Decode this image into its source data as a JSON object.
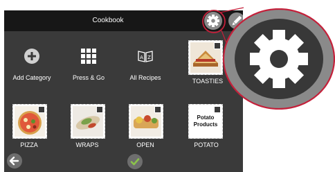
{
  "header": {
    "title": "Cookbook"
  },
  "actions": [
    {
      "label": "Add Category",
      "icon": "plus-icon"
    },
    {
      "label": "Press & Go",
      "icon": "grid-icon"
    },
    {
      "label": "All Recipes",
      "icon": "book-az-icon"
    }
  ],
  "categories": [
    {
      "label": "TOASTIES"
    },
    {
      "label": "PIZZA"
    },
    {
      "label": "WRAPS"
    },
    {
      "label": "OPEN"
    },
    {
      "label": "POTATO",
      "image_text": "Potato Products"
    }
  ],
  "icons": {
    "settings": "gear-icon",
    "edit": "pencil-icon",
    "back": "arrow-left-icon",
    "confirm": "check-icon",
    "zoom": "gear-icon"
  },
  "colors": {
    "screen_bg": "#3a3a3a",
    "titlebar_bg": "#171717",
    "callout": "#c4203a",
    "confirm_check": "#8bc34a"
  }
}
